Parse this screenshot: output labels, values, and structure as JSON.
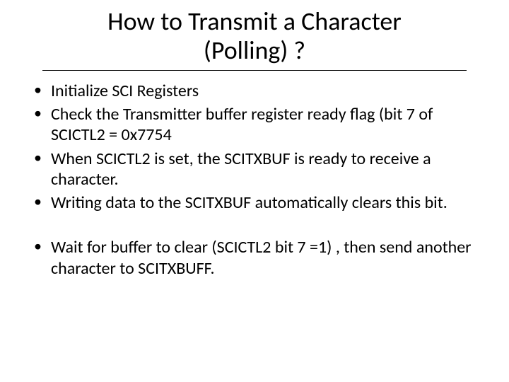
{
  "title_line1": "How to Transmit a Character",
  "title_line2": "(Polling) ?",
  "bullets": {
    "b0": "Initialize SCI Registers",
    "b1": "Check the Transmitter buffer register ready flag (bit 7 of SCICTL2 = 0x7754",
    "b2": "When SCICTL2 is set, the SCITXBUF is ready to receive a character.",
    "b3": "Writing data to the SCITXBUF automatically clears this bit.",
    "b4": "Wait for buffer to clear (SCICTL2 bit 7 =1) , then send another character to SCITXBUFF."
  }
}
